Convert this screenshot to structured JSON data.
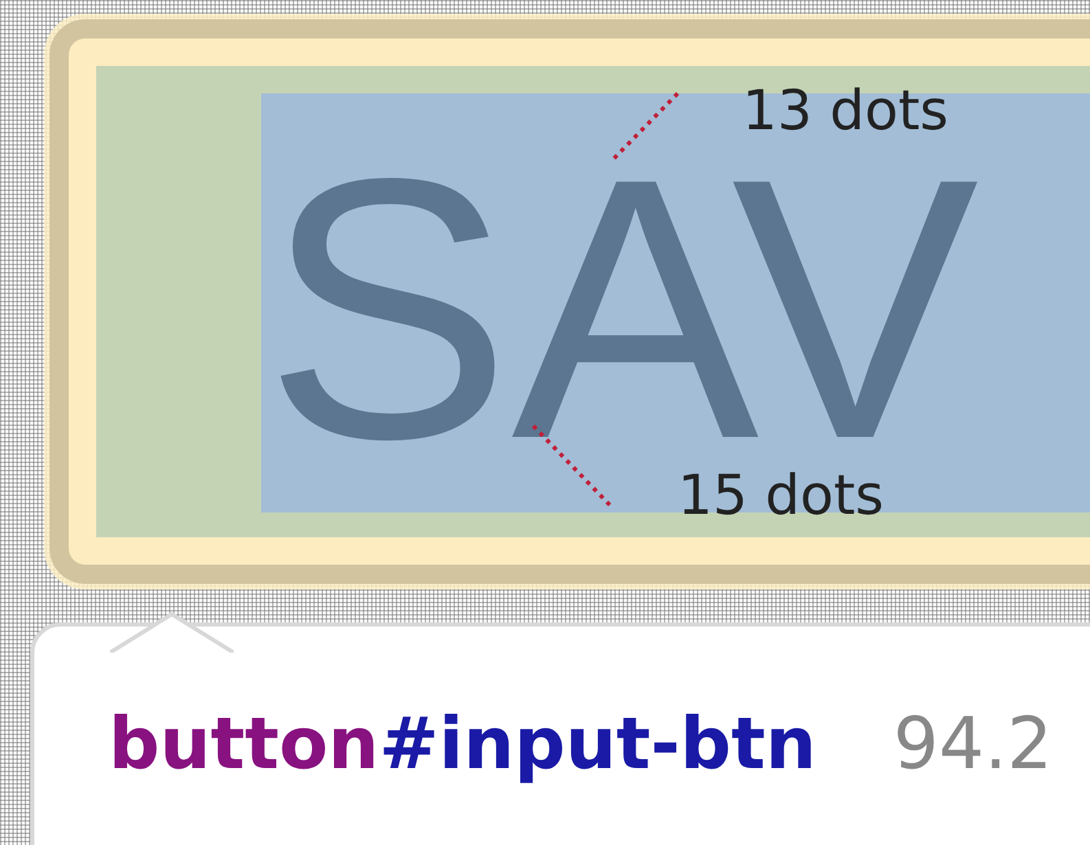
{
  "button": {
    "label": "SAV"
  },
  "annotations": [
    {
      "text": "13 dots"
    },
    {
      "text": "15 dots"
    }
  ],
  "tooltip": {
    "tag": "button",
    "id": "#input-btn",
    "size": "94.2"
  }
}
